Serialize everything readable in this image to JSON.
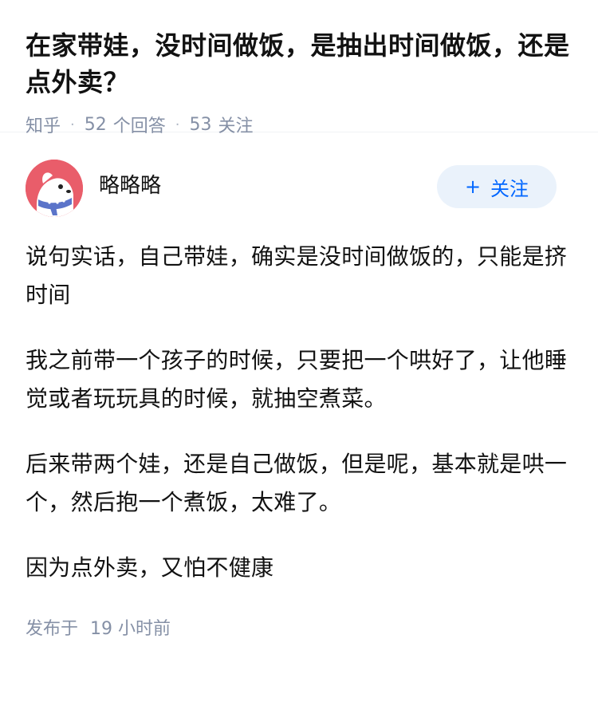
{
  "question": {
    "title": "在家带娃，没时间做饭，是抽出时间做饭，还是点外卖？",
    "source": "知乎",
    "separator": "·",
    "answer_count": "52",
    "answer_label": "个回答",
    "follow_count": "53",
    "follow_label": "关注"
  },
  "answer": {
    "author_name": "略略略",
    "follow_button": {
      "icon": "plus-icon",
      "icon_glyph": "+",
      "label": "关注"
    },
    "paragraphs": [
      "说句实话，自己带娃，确实是没时间做饭的，只能是挤时间",
      "我之前带一个孩子的时候，只要把一个哄好了，让他睡觉或者玩玩具的时候，就抽空煮菜。",
      "后来带两个娃，还是自己做饭，但是呢，基本就是哄一个，然后抱一个煮饭，太难了。",
      "因为点外卖，又怕不健康"
    ],
    "published_label": "发布于",
    "published_time": "19 小时前"
  },
  "colors": {
    "title": "#121212",
    "meta": "#8590a6",
    "follow_button_bg": "#eaf2fb",
    "follow_button_text": "#0066ff",
    "avatar_bg": "#e95d6a"
  }
}
